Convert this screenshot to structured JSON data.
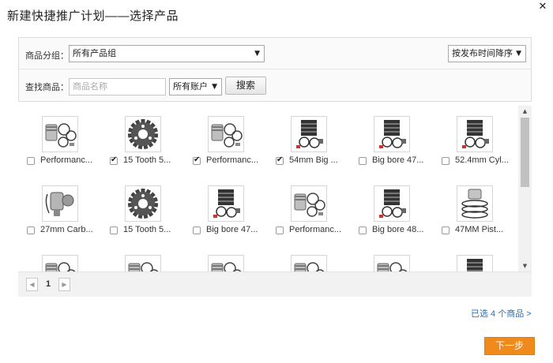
{
  "dialog": {
    "title": "新建快捷推广计划——选择产品",
    "close_glyph": "✕"
  },
  "filters": {
    "group_label": "商品分组：",
    "group_value": "所有产品组",
    "sort_value": "按发布时间降序",
    "search_label": "查找商品：",
    "search_placeholder": "商品名称",
    "search_value": "",
    "account_value": "所有账户",
    "search_button": "搜索",
    "dropdown_arrow": "▼"
  },
  "products": [
    {
      "name": "Performanc...",
      "checked": false,
      "icon": "piston-kit-icon"
    },
    {
      "name": "15 Tooth 5...",
      "checked": true,
      "icon": "sprocket-icon"
    },
    {
      "name": "Performanc...",
      "checked": true,
      "icon": "piston-kit-icon"
    },
    {
      "name": "54mm Big ...",
      "checked": true,
      "icon": "cylinder-kit-icon"
    },
    {
      "name": "Big bore 47...",
      "checked": false,
      "icon": "cylinder-kit-icon"
    },
    {
      "name": "52.4mm Cyl...",
      "checked": false,
      "icon": "cylinder-kit-icon"
    },
    {
      "name": "27mm Carb...",
      "checked": false,
      "icon": "carburetor-icon"
    },
    {
      "name": "15 Tooth 5...",
      "checked": false,
      "icon": "sprocket-icon"
    },
    {
      "name": "Big bore 47...",
      "checked": false,
      "icon": "cylinder-kit-icon"
    },
    {
      "name": "Performanc...",
      "checked": false,
      "icon": "piston-kit-icon"
    },
    {
      "name": "Big bore 48...",
      "checked": false,
      "icon": "cylinder-kit-icon"
    },
    {
      "name": "47MM Pist...",
      "checked": false,
      "icon": "piston-rings-icon"
    },
    {
      "name": "",
      "checked": false,
      "icon": "piston-kit-icon"
    },
    {
      "name": "",
      "checked": false,
      "icon": "piston-kit-icon"
    },
    {
      "name": "",
      "checked": false,
      "icon": "piston-kit-icon"
    },
    {
      "name": "",
      "checked": false,
      "icon": "piston-kit-icon"
    },
    {
      "name": "",
      "checked": false,
      "icon": "piston-kit-icon"
    },
    {
      "name": "",
      "checked": false,
      "icon": "cylinder-kit-icon"
    }
  ],
  "scrollbar": {
    "up_glyph": "▲",
    "down_glyph": "▼"
  },
  "pager": {
    "prev_glyph": "◀",
    "current_page": "1",
    "next_glyph": "▶"
  },
  "footer": {
    "selected_summary": "已选 4 个商品 >",
    "next_button": "下一步"
  },
  "colors": {
    "accent_orange": "#f08a1c",
    "link_blue": "#2a6db5"
  }
}
